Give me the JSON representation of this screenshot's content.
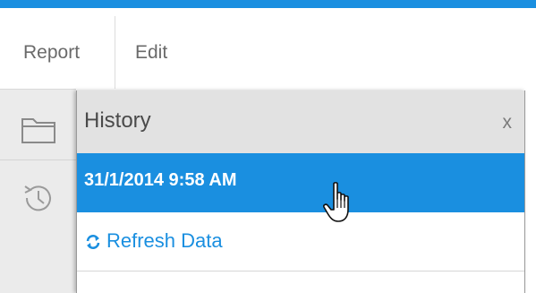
{
  "colors": {
    "accent": "#1a8fe0",
    "rail_bg": "#ebebeb",
    "panel_header_bg": "#e2e2e2",
    "selected_row_bg": "#1a8fe0"
  },
  "menubar": {
    "items": [
      {
        "label": "Report"
      },
      {
        "label": "Edit"
      }
    ]
  },
  "side_rail": {
    "icons": [
      "folder-icon",
      "history-icon"
    ]
  },
  "history_panel": {
    "title": "History",
    "close_label": "x",
    "entries": [
      {
        "label": "31/1/2014 9:58 AM",
        "selected": true
      }
    ],
    "refresh": {
      "icon": "refresh-icon",
      "label": "Refresh Data"
    }
  },
  "cursor": {
    "icon": "hand-pointer-icon"
  }
}
